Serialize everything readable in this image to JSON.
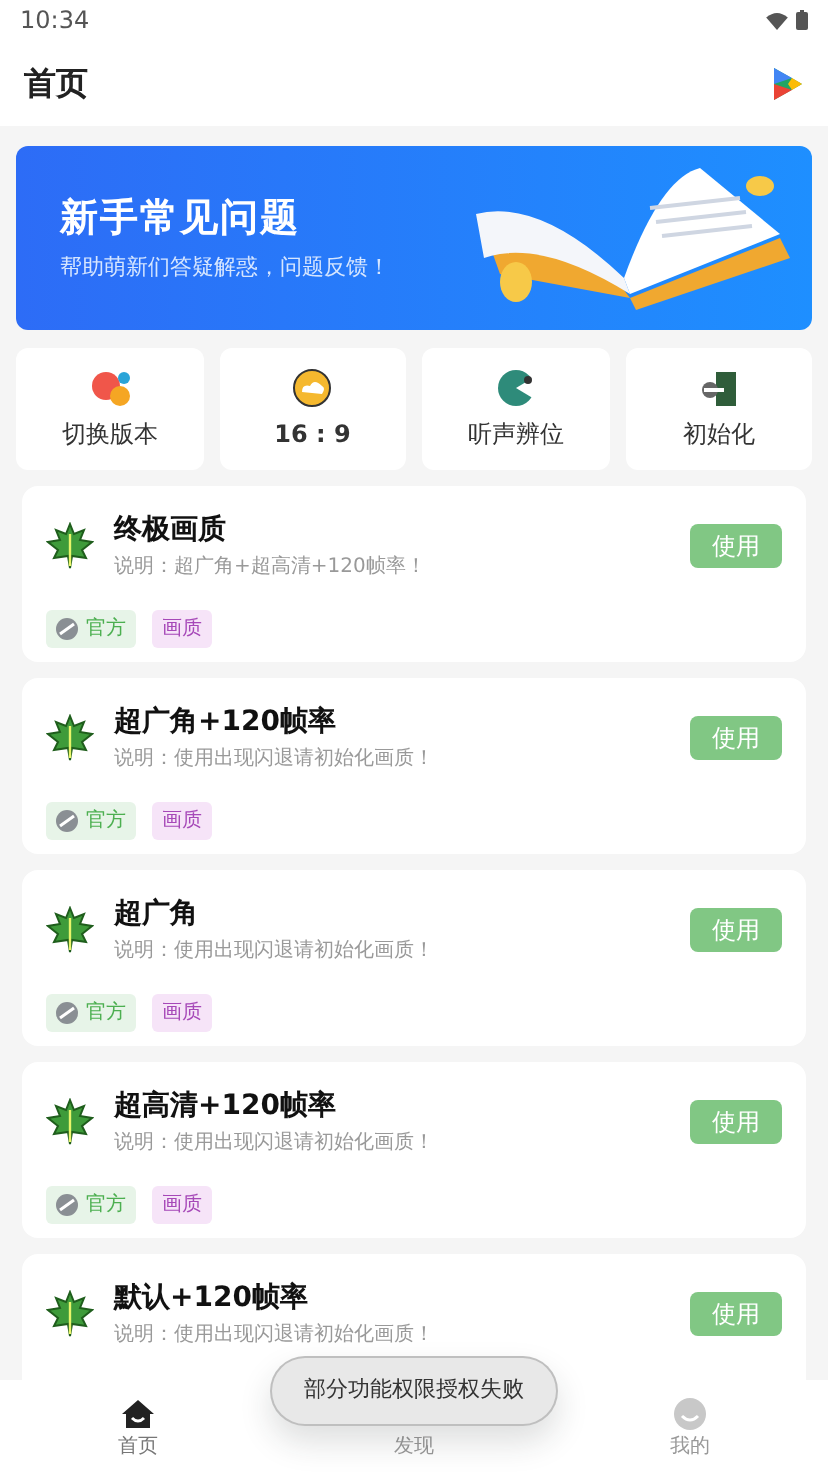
{
  "status_bar": {
    "time": "10:34"
  },
  "header": {
    "title": "首页"
  },
  "banner": {
    "title": "新手常见问题",
    "subtitle": "帮助萌新们答疑解惑，问题反馈！"
  },
  "shortcuts": [
    {
      "kind": "switch",
      "label": "切换版本"
    },
    {
      "kind": "ratio",
      "label": "16 : 9"
    },
    {
      "kind": "sound",
      "label": "听声辨位"
    },
    {
      "kind": "reset",
      "label": "初始化"
    }
  ],
  "presets": [
    {
      "title": "终极画质",
      "description": "说明：超广角+超高清+120帧率！",
      "button": "使用",
      "tags": [
        {
          "kind": "official",
          "label": "官方"
        },
        {
          "kind": "quality",
          "label": "画质"
        }
      ]
    },
    {
      "title": "超广角+120帧率",
      "description": "说明：使用出现闪退请初始化画质！",
      "button": "使用",
      "tags": [
        {
          "kind": "official",
          "label": "官方"
        },
        {
          "kind": "quality",
          "label": "画质"
        }
      ]
    },
    {
      "title": "超广角",
      "description": "说明：使用出现闪退请初始化画质！",
      "button": "使用",
      "tags": [
        {
          "kind": "official",
          "label": "官方"
        },
        {
          "kind": "quality",
          "label": "画质"
        }
      ]
    },
    {
      "title": "超高清+120帧率",
      "description": "说明：使用出现闪退请初始化画质！",
      "button": "使用",
      "tags": [
        {
          "kind": "official",
          "label": "官方"
        },
        {
          "kind": "quality",
          "label": "画质"
        }
      ]
    },
    {
      "title": "默认+120帧率",
      "description": "说明：使用出现闪退请初始化画质！",
      "button": "使用"
    }
  ],
  "bottom_nav": [
    {
      "kind": "home",
      "label": "首页",
      "selected": true
    },
    {
      "kind": "discover",
      "label": "发现",
      "selected": false
    },
    {
      "kind": "me",
      "label": "我的",
      "selected": false
    }
  ],
  "toast": "部分功能权限授权失败"
}
